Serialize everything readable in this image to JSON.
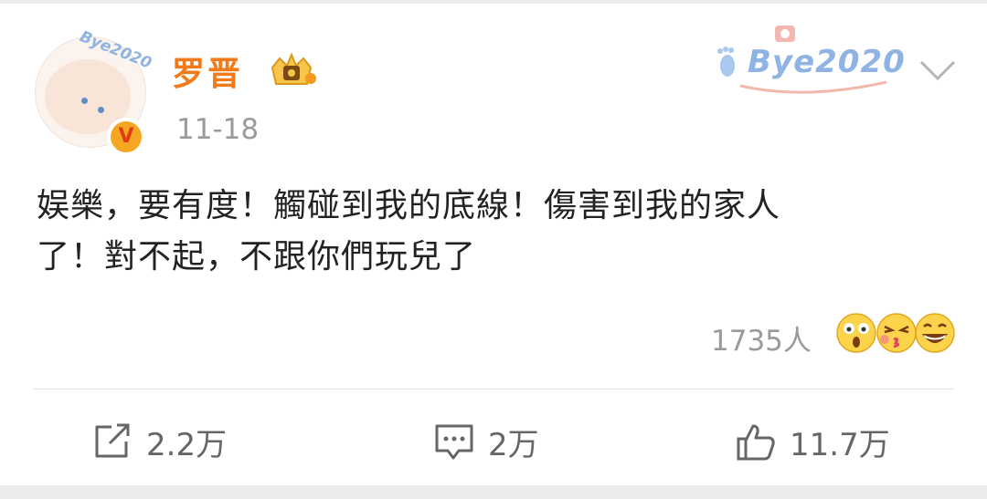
{
  "post": {
    "author": "罗晋",
    "timestamp": "11-18",
    "avatar_tag": "Bye2020",
    "header_decoration": "Bye2020",
    "verified_mark": "V",
    "content_line1": "娱樂，要有度！觸碰到我的底線！傷害到我的家人",
    "content_line2": "了！對不起，不跟你們玩兒了",
    "reactions": {
      "count": "1735人",
      "emojis": [
        "shocked-emoji",
        "kiss-emoji",
        "grin-emoji"
      ]
    }
  },
  "actions": {
    "share_count": "2.2万",
    "comment_count": "2万",
    "like_count": "11.7万"
  },
  "colors": {
    "name": "#f27a18",
    "muted": "#9a9a9a",
    "text": "#222222",
    "accent_blue": "#8fb4e4"
  }
}
